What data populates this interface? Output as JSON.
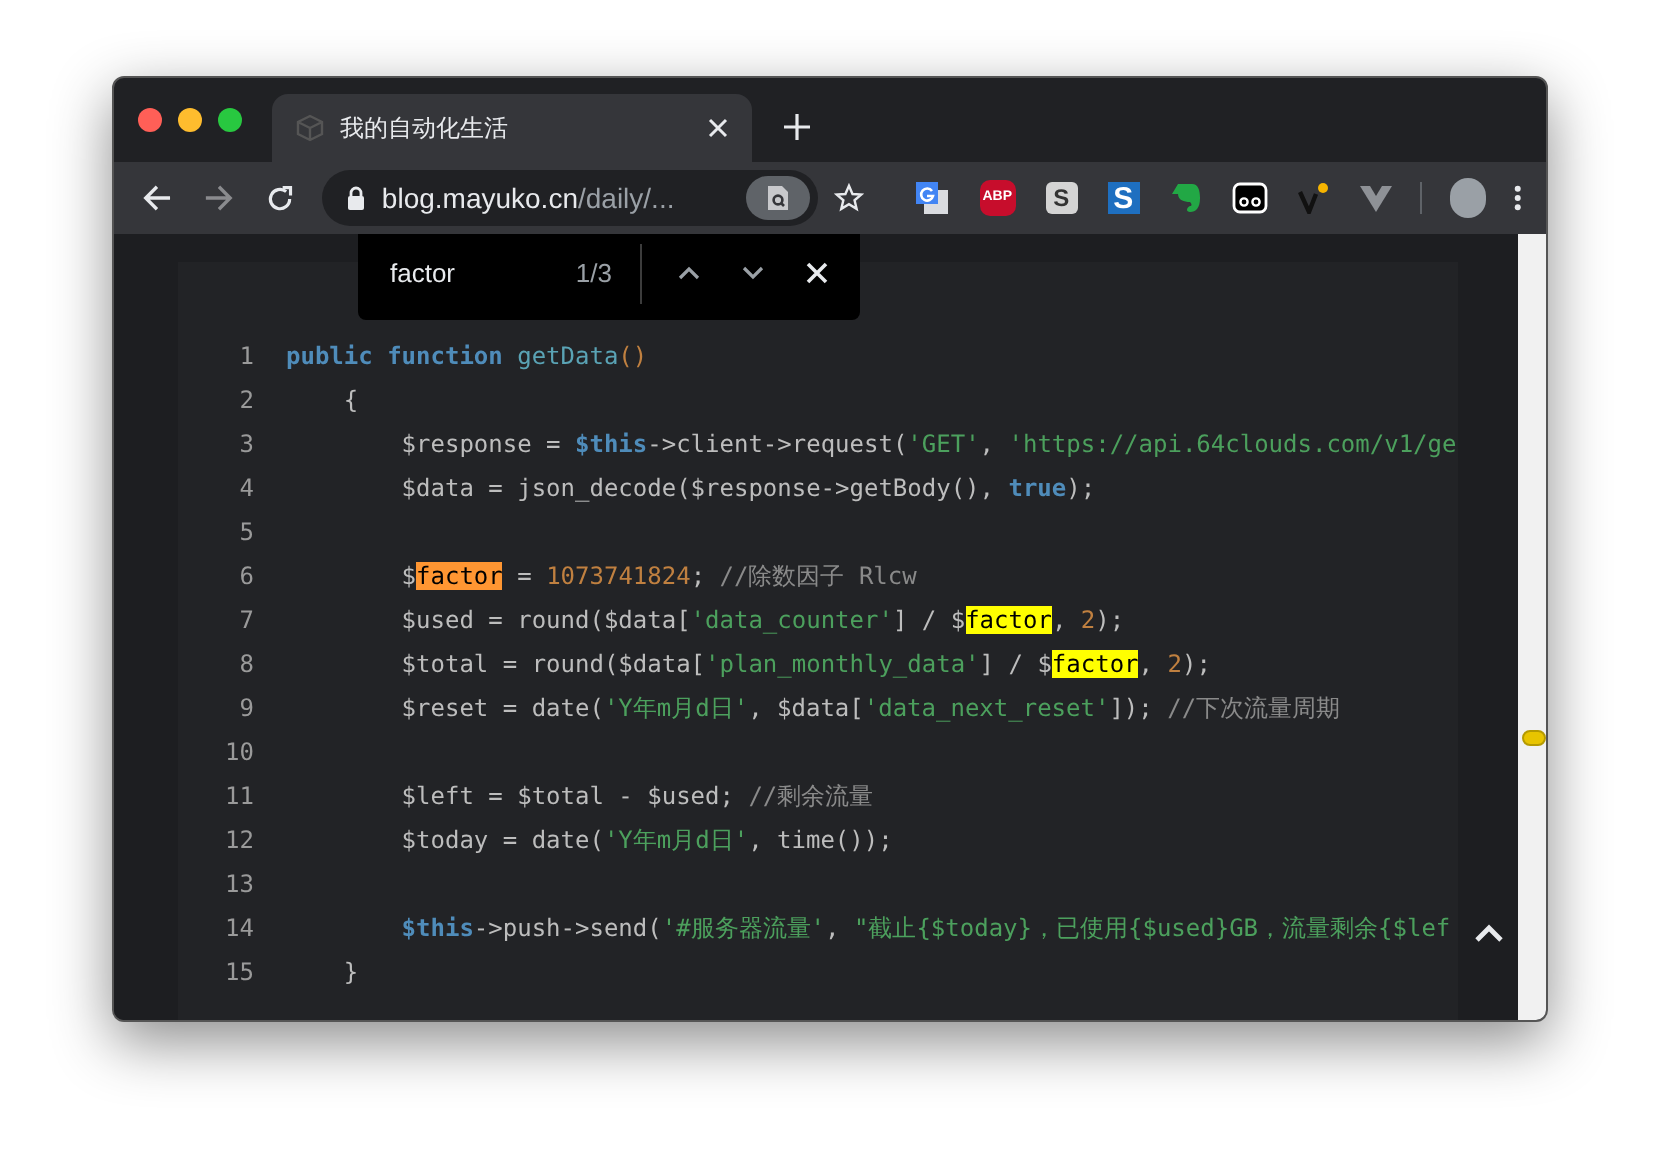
{
  "window": {
    "tab": {
      "title": "我的自动化生活",
      "selected": true
    }
  },
  "toolbar": {
    "url_host": "blog.mayuko.cn",
    "url_path": "/daily/...",
    "extensions": [
      {
        "kind": "translate"
      },
      {
        "kind": "abp",
        "label": "ABP"
      },
      {
        "kind": "s-grey",
        "label": "S"
      },
      {
        "kind": "s-blue",
        "label": "S"
      },
      {
        "kind": "elephant"
      },
      {
        "kind": "face"
      },
      {
        "kind": "v-dot"
      },
      {
        "kind": "v-grey"
      }
    ]
  },
  "find_bar": {
    "query": "factor",
    "count": "1/3"
  },
  "code": {
    "lines": [
      {
        "number": "1",
        "tokens": [
          {
            "kind": "keyword",
            "text": "public function "
          },
          {
            "kind": "func",
            "text": "getData"
          },
          {
            "kind": "number",
            "text": "()"
          }
        ]
      },
      {
        "number": "2",
        "tokens": [
          {
            "kind": "plain",
            "text": "    {"
          }
        ]
      },
      {
        "number": "3",
        "tokens": [
          {
            "kind": "plain",
            "text": "        $response = "
          },
          {
            "kind": "keyword",
            "text": "$this"
          },
          {
            "kind": "plain",
            "text": "->client->request("
          },
          {
            "kind": "string",
            "text": "'GET'"
          },
          {
            "kind": "plain",
            "text": ", "
          },
          {
            "kind": "string",
            "text": "'https://api.64clouds.com/v1/ge"
          }
        ]
      },
      {
        "number": "4",
        "tokens": [
          {
            "kind": "plain",
            "text": "        $data = json_decode($response->getBody(), "
          },
          {
            "kind": "keyword",
            "text": "true"
          },
          {
            "kind": "plain",
            "text": ");"
          }
        ]
      },
      {
        "number": "5"
      },
      {
        "number": "6",
        "tokens": [
          {
            "kind": "plain",
            "text": "        $"
          },
          {
            "kind": "match-current",
            "text": "factor"
          },
          {
            "kind": "plain",
            "text": " = "
          },
          {
            "kind": "number",
            "text": "1073741824"
          },
          {
            "kind": "plain",
            "text": "; "
          },
          {
            "kind": "comment",
            "text": "//除数因子 Rlcw"
          }
        ]
      },
      {
        "number": "7",
        "tokens": [
          {
            "kind": "plain",
            "text": "        $used = round($data["
          },
          {
            "kind": "string",
            "text": "'data_counter'"
          },
          {
            "kind": "plain",
            "text": "] / $"
          },
          {
            "kind": "match",
            "text": "factor"
          },
          {
            "kind": "plain",
            "text": ", "
          },
          {
            "kind": "number",
            "text": "2"
          },
          {
            "kind": "plain",
            "text": ");"
          }
        ]
      },
      {
        "number": "8",
        "tokens": [
          {
            "kind": "plain",
            "text": "        $total = round($data["
          },
          {
            "kind": "string",
            "text": "'plan_monthly_data'"
          },
          {
            "kind": "plain",
            "text": "] / $"
          },
          {
            "kind": "match",
            "text": "factor"
          },
          {
            "kind": "plain",
            "text": ", "
          },
          {
            "kind": "number",
            "text": "2"
          },
          {
            "kind": "plain",
            "text": ");"
          }
        ]
      },
      {
        "number": "9",
        "tokens": [
          {
            "kind": "plain",
            "text": "        $reset = date("
          },
          {
            "kind": "string",
            "text": "'Y年m月d日'"
          },
          {
            "kind": "plain",
            "text": ", $data["
          },
          {
            "kind": "string",
            "text": "'data_next_reset'"
          },
          {
            "kind": "plain",
            "text": "]); "
          },
          {
            "kind": "comment",
            "text": "//下次流量周期"
          }
        ]
      },
      {
        "number": "10"
      },
      {
        "number": "11",
        "tokens": [
          {
            "kind": "plain",
            "text": "        $left = $total - $used; "
          },
          {
            "kind": "comment",
            "text": "//剩余流量"
          }
        ]
      },
      {
        "number": "12",
        "tokens": [
          {
            "kind": "plain",
            "text": "        $today = date("
          },
          {
            "kind": "string",
            "text": "'Y年m月d日'"
          },
          {
            "kind": "plain",
            "text": ", time());"
          }
        ]
      },
      {
        "number": "13"
      },
      {
        "number": "14",
        "tokens": [
          {
            "kind": "keyword",
            "text": "        $this"
          },
          {
            "kind": "plain",
            "text": "->push->send("
          },
          {
            "kind": "string",
            "text": "'#服务器流量'"
          },
          {
            "kind": "plain",
            "text": ", "
          },
          {
            "kind": "string",
            "text": "\"截止{$today}，已使用{$used}GB，流量剩余{$lef"
          }
        ]
      },
      {
        "number": "15",
        "tokens": [
          {
            "kind": "plain",
            "text": "    }"
          }
        ]
      }
    ]
  }
}
